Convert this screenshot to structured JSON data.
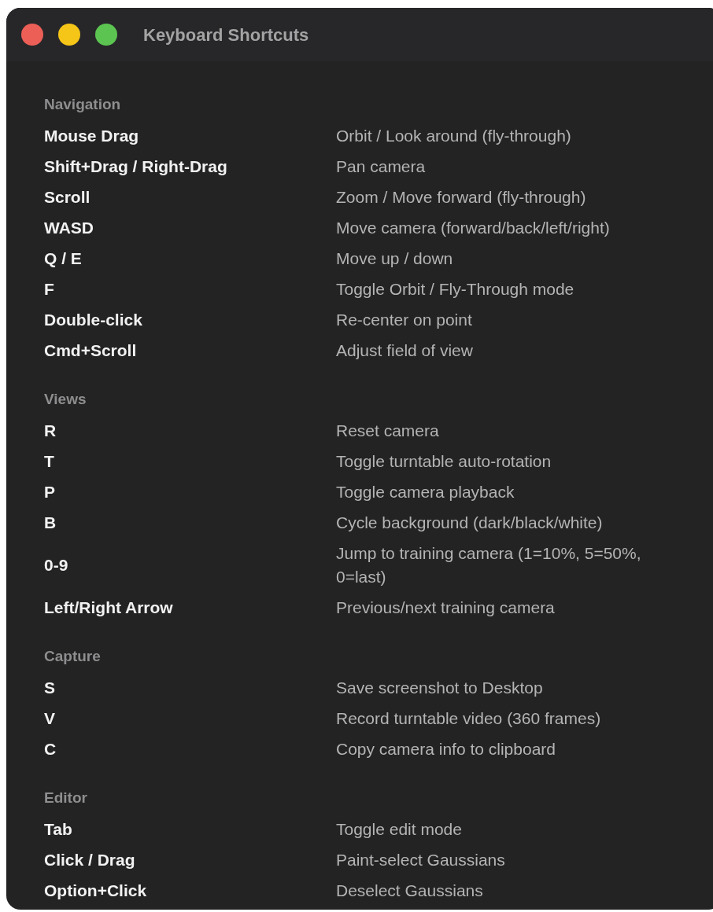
{
  "window": {
    "title": "Keyboard Shortcuts"
  },
  "sections": [
    {
      "title": "Navigation",
      "shortcuts": [
        {
          "keys": "Mouse Drag",
          "action": "Orbit / Look around (fly-through)"
        },
        {
          "keys": "Shift+Drag / Right-Drag",
          "action": "Pan camera"
        },
        {
          "keys": "Scroll",
          "action": "Zoom / Move forward (fly-through)"
        },
        {
          "keys": "WASD",
          "action": "Move camera (forward/back/left/right)"
        },
        {
          "keys": "Q / E",
          "action": "Move up / down"
        },
        {
          "keys": "F",
          "action": "Toggle Orbit / Fly-Through mode"
        },
        {
          "keys": "Double-click",
          "action": "Re-center on point"
        },
        {
          "keys": "Cmd+Scroll",
          "action": "Adjust field of view"
        }
      ]
    },
    {
      "title": "Views",
      "shortcuts": [
        {
          "keys": "R",
          "action": "Reset camera"
        },
        {
          "keys": "T",
          "action": "Toggle turntable auto-rotation"
        },
        {
          "keys": "P",
          "action": "Toggle camera playback"
        },
        {
          "keys": "B",
          "action": "Cycle background (dark/black/white)"
        },
        {
          "keys": "0-9",
          "action": "Jump to training camera (1=10%, 5=50%, 0=last)"
        },
        {
          "keys": "Left/Right Arrow",
          "action": "Previous/next training camera"
        }
      ]
    },
    {
      "title": "Capture",
      "shortcuts": [
        {
          "keys": "S",
          "action": "Save screenshot to Desktop"
        },
        {
          "keys": "V",
          "action": "Record turntable video (360 frames)"
        },
        {
          "keys": "C",
          "action": "Copy camera info to clipboard"
        }
      ]
    },
    {
      "title": "Editor",
      "shortcuts": [
        {
          "keys": "Tab",
          "action": "Toggle edit mode"
        },
        {
          "keys": "Click / Drag",
          "action": "Paint-select Gaussians"
        },
        {
          "keys": "Option+Click",
          "action": "Deselect Gaussians"
        }
      ]
    }
  ]
}
